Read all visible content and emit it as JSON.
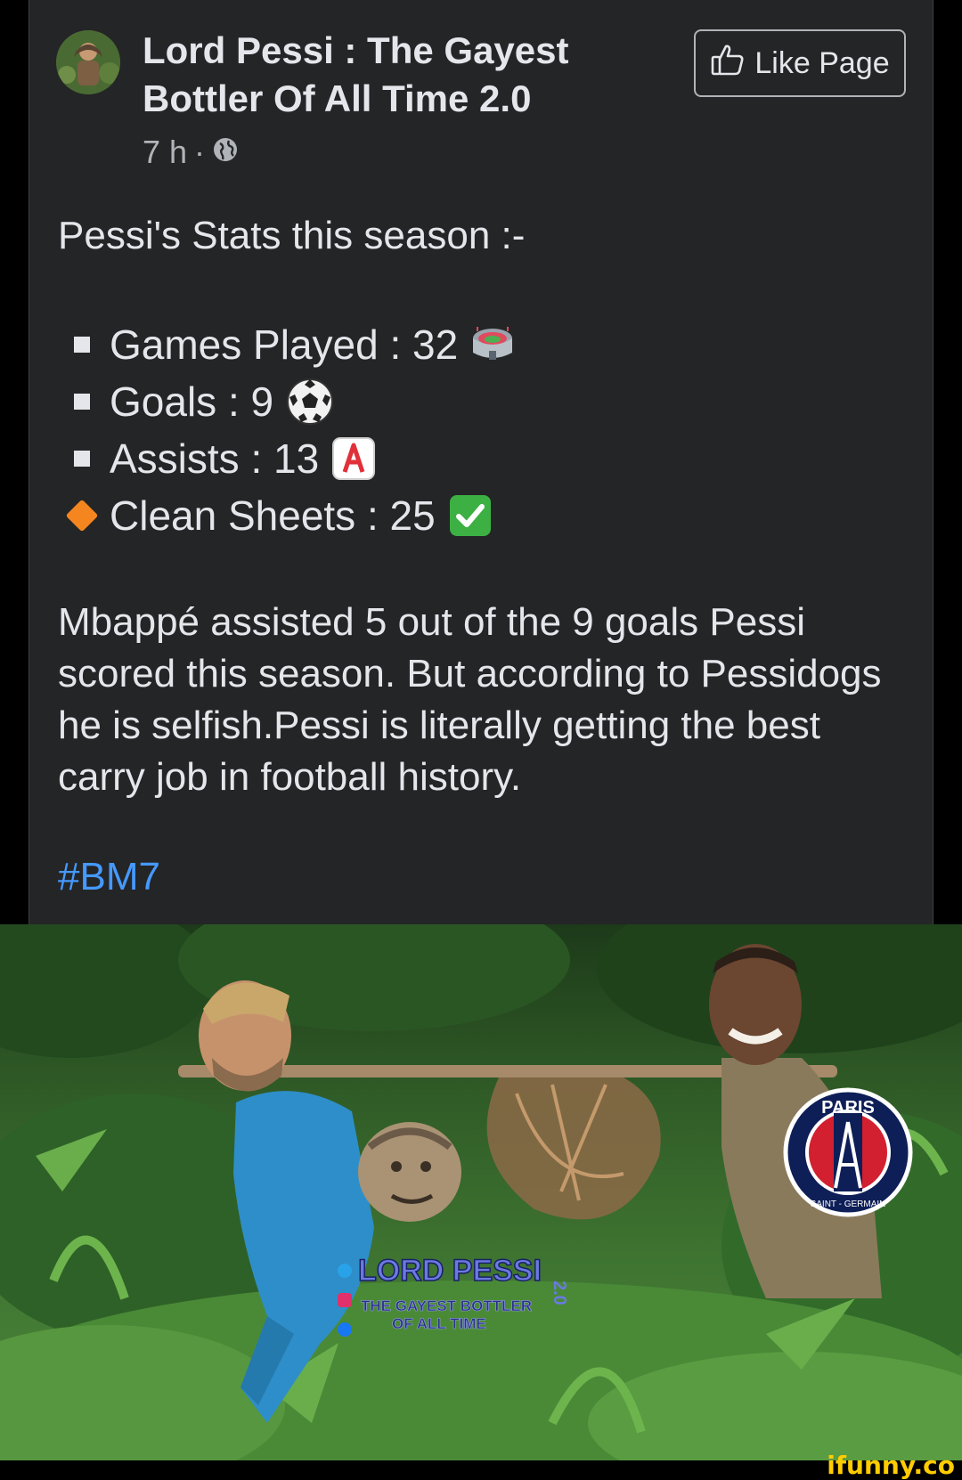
{
  "post": {
    "page_name": "Lord Pessi : The Gayest Bottler Of All Time 2.0",
    "time": "7 h",
    "separator": "·",
    "privacy_icon": "globe-icon",
    "like_button": "Like Page",
    "like_icon": "thumbs-up-icon",
    "intro": "Pessi's Stats this season :-",
    "stats": [
      {
        "bullet": "square",
        "label": "Games Played : 32",
        "emoji": "stadium-icon"
      },
      {
        "bullet": "square",
        "label": "Goals : 9",
        "emoji": "soccer-ball-icon"
      },
      {
        "bullet": "square",
        "label": "Assists : 13",
        "emoji": "letter-a-icon"
      },
      {
        "bullet": "diamond",
        "label": "Clean Sheets : 25",
        "emoji": "check-mark-icon"
      }
    ],
    "body": "Mbappé assisted 5 out of the 9 goals Pessi scored this season. But according to Pessidogs he is selfish.Pessi is literally getting the best carry job in football history.",
    "hashtag": "#BM7"
  },
  "image": {
    "watermark_title": "LORD PESSI",
    "watermark_version": "2.0",
    "watermark_sub1": "THE GAYEST BOTTLER",
    "watermark_sub2": "OF ALL TIME",
    "badge_top": "PARIS",
    "badge_bottom": "SAINT - GERMAIN"
  },
  "site_watermark": "ifunny.co",
  "colors": {
    "background": "#242526",
    "text": "#e4e6eb",
    "secondary_text": "#b0b3b8",
    "hashtag": "#4599ff",
    "diamond": "#f5861f",
    "ifunny": "#ffcc00"
  }
}
